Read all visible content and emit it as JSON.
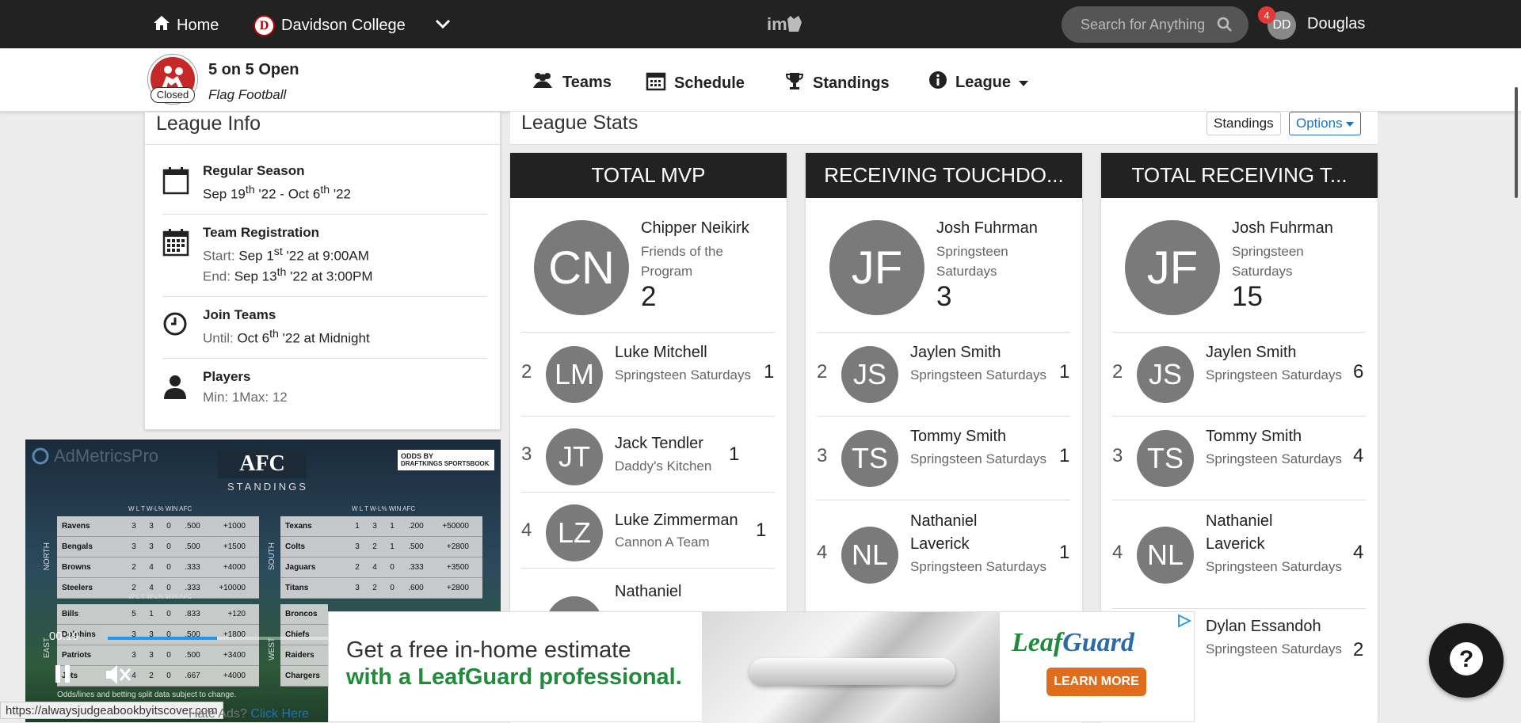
{
  "topbar": {
    "home_label": "Home",
    "school_label": "Davidson College",
    "search_placeholder": "Search for Anything",
    "notification_count": "4",
    "user_initials": "DD",
    "user_name": "Douglas"
  },
  "league": {
    "name": "5 on 5 Open",
    "sport": "Flag Football",
    "status": "Closed"
  },
  "nav": {
    "teams": "Teams",
    "schedule": "Schedule",
    "standings": "Standings",
    "league": "League"
  },
  "league_info": {
    "title": "League Info",
    "regular_season": {
      "title": "Regular Season",
      "start_day": "Sep 19",
      "start_sup": "th",
      "start_year": " '22 - Oct 6",
      "end_sup": "th",
      "end_year": " '22"
    },
    "team_registration": {
      "title": "Team Registration",
      "start_label": "Start:",
      "start_date": " Sep 1",
      "start_sup": "st",
      "start_rest": " '22 at 9:00AM",
      "end_label": "End:",
      "end_date": " Sep 13",
      "end_sup": "th",
      "end_rest": " '22 at 3:00PM"
    },
    "join_teams": {
      "title": "Join Teams",
      "until_label": "Until:",
      "until_date": " Oct 6",
      "until_sup": "th",
      "until_rest": " '22 at Midnight"
    },
    "players": {
      "title": "Players",
      "limits": "Min: 1Max: 12"
    }
  },
  "league_stats": {
    "title": "League Stats",
    "standings_button": "Standings",
    "options_button": "Options"
  },
  "cards": [
    {
      "header": "TOTAL MVP",
      "mvp": {
        "initials": "CN",
        "name": "Chipper Neikirk",
        "team": "Friends of the Program",
        "value": "2"
      },
      "rows": [
        {
          "rank": "2",
          "initials": "LM",
          "name": "Luke Mitchell",
          "team": "Springsteen Saturdays",
          "value": "1"
        },
        {
          "rank": "3",
          "initials": "JT",
          "name": "Jack Tendler",
          "team": "Daddy's Kitchen",
          "value": "1"
        },
        {
          "rank": "4",
          "initials": "LZ",
          "name": "Luke Zimmerman",
          "team": "Cannon A Team",
          "value": "1"
        },
        {
          "rank": "",
          "initials": "",
          "name": "Nathaniel",
          "team": "",
          "value": ""
        }
      ]
    },
    {
      "header": "RECEIVING TOUCHDO...",
      "mvp": {
        "initials": "JF",
        "name": "Josh Fuhrman",
        "team": "Springsteen Saturdays",
        "value": "3"
      },
      "rows": [
        {
          "rank": "2",
          "initials": "JS",
          "name": "Jaylen Smith",
          "team": "Springsteen Saturdays",
          "value": "1"
        },
        {
          "rank": "3",
          "initials": "TS",
          "name": "Tommy Smith",
          "team": "Springsteen Saturdays",
          "value": "1"
        },
        {
          "rank": "4",
          "initials": "NL",
          "name": "Nathaniel Laverick",
          "team": "Springsteen Saturdays",
          "value": "1"
        }
      ]
    },
    {
      "header": "TOTAL RECEIVING T...",
      "mvp": {
        "initials": "JF",
        "name": "Josh Fuhrman",
        "team": "Springsteen Saturdays",
        "value": "15"
      },
      "rows": [
        {
          "rank": "2",
          "initials": "JS",
          "name": "Jaylen Smith",
          "team": "Springsteen Saturdays",
          "value": "6"
        },
        {
          "rank": "3",
          "initials": "TS",
          "name": "Tommy Smith",
          "team": "Springsteen Saturdays",
          "value": "4"
        },
        {
          "rank": "4",
          "initials": "NL",
          "name": "Nathaniel Laverick",
          "team": "Springsteen Saturdays",
          "value": "4"
        },
        {
          "rank": "",
          "initials": "",
          "name": "Dylan Essandoh",
          "team": "Springsteen Saturdays",
          "value": "2"
        }
      ]
    }
  ],
  "video_ad": {
    "brand": "AdMetricsPro",
    "heading": "AFC",
    "subheading": "STANDINGS",
    "odds_by": "ODDS BY",
    "odds_brand": "DRAFTKINGS SPORTSBOOK",
    "columns": [
      "W",
      "L",
      "T",
      "W-L%",
      "WIN AFC"
    ],
    "north_label": "NORTH",
    "south_label": "SOUTH",
    "east_label": "EAST",
    "west_label": "WEST",
    "north": [
      {
        "team": "Ravens",
        "w": "3",
        "l": "3",
        "t": "0",
        "pct": ".500",
        "odds": "+1000"
      },
      {
        "team": "Bengals",
        "w": "3",
        "l": "3",
        "t": "0",
        "pct": ".500",
        "odds": "+1500"
      },
      {
        "team": "Browns",
        "w": "2",
        "l": "4",
        "t": "0",
        "pct": ".333",
        "odds": "+4000"
      },
      {
        "team": "Steelers",
        "w": "2",
        "l": "4",
        "t": "0",
        "pct": ".333",
        "odds": "+10000"
      }
    ],
    "south": [
      {
        "team": "Texans",
        "w": "1",
        "l": "3",
        "t": "1",
        "pct": ".200",
        "odds": "+50000"
      },
      {
        "team": "Colts",
        "w": "3",
        "l": "2",
        "t": "1",
        "pct": ".500",
        "odds": "+2800"
      },
      {
        "team": "Jaguars",
        "w": "2",
        "l": "4",
        "t": "0",
        "pct": ".333",
        "odds": "+3500"
      },
      {
        "team": "Titans",
        "w": "3",
        "l": "2",
        "t": "0",
        "pct": ".600",
        "odds": "+2800"
      }
    ],
    "east": [
      {
        "team": "Bills",
        "w": "5",
        "l": "1",
        "t": "0",
        "pct": ".833",
        "odds": "+120"
      },
      {
        "team": "Dolphins",
        "w": "3",
        "l": "3",
        "t": "0",
        "pct": ".500",
        "odds": "+1800"
      },
      {
        "team": "Patriots",
        "w": "3",
        "l": "3",
        "t": "0",
        "pct": ".500",
        "odds": "+3400"
      },
      {
        "team": "Jets",
        "w": "4",
        "l": "2",
        "t": "0",
        "pct": ".667",
        "odds": "+4000"
      }
    ],
    "west": [
      {
        "team": "Broncos"
      },
      {
        "team": "Chiefs"
      },
      {
        "team": "Raiders"
      },
      {
        "team": "Chargers"
      }
    ],
    "time": "00:19",
    "progress": 0.4,
    "note": "Odds/lines and betting split data subject to change."
  },
  "status_url": "https://alwaysjudgeabookbyitscover.com",
  "hate_ads": {
    "text": "Hate Ads? ",
    "link": "Click Here"
  },
  "banner_ad": {
    "line1": "Get a free in-home estimate",
    "line2": "with a LeafGuard professional.",
    "brand_leaf": "Leaf",
    "brand_guard": "Guard",
    "cta": "LEARN MORE"
  },
  "colors": {
    "topbar": "#222222",
    "league_red": "#c62828",
    "accent_blue": "#1e73be",
    "avatar_gray": "#7a7a7a",
    "leafguard_green": "#1e8c3a",
    "leafguard_orange": "#e06d1c"
  }
}
